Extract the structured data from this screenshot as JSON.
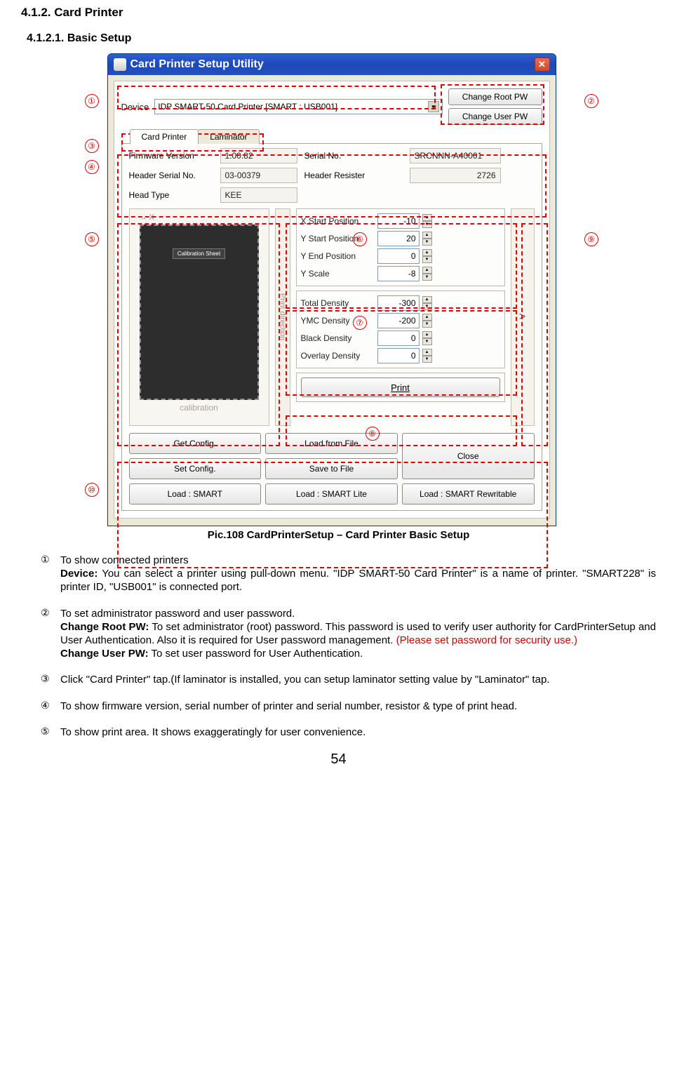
{
  "headings": {
    "h1": "4.1.2. Card Printer",
    "h2": "4.1.2.1. Basic Setup"
  },
  "titlebar": {
    "title": "Card Printer Setup Utility"
  },
  "device": {
    "label": "Device",
    "value": "IDP SMART-50 Card Printer  [SMART : USB001]",
    "btn_root": "Change Root PW",
    "btn_user": "Change User PW"
  },
  "tabs": {
    "card_printer": "Card Printer",
    "laminator": "Laminator"
  },
  "info": {
    "firmware_label": "Firmware Version",
    "firmware_value": "1.00.82",
    "serial_label": "Serial No.",
    "serial_value": "SRCNNN-A40001",
    "header_serial_label": "Header Serial No.",
    "header_serial_value": "03-00379",
    "header_resister_label": "Header Resister",
    "header_resister_value": "2726",
    "head_type_label": "Head Type",
    "head_type_value": "KEE"
  },
  "calibration": {
    "sheet": "Calibration Sheet",
    "caption": "calibration",
    "print_direction": "Print direction"
  },
  "params": {
    "xstart_label": "X Start Position",
    "xstart_value": "-10",
    "ystart_label": "Y Start Position",
    "ystart_value": "20",
    "yend_label": "Y End Position",
    "yend_value": "0",
    "yscale_label": "Y Scale",
    "yscale_value": "-8",
    "total_density_label": "Total Density",
    "total_density_value": "-300",
    "ymc_density_label": "YMC Density",
    "ymc_density_value": "-200",
    "black_density_label": "Black Density",
    "black_density_value": "0",
    "overlay_density_label": "Overlay Density",
    "overlay_density_value": "0"
  },
  "print_btn": "Print",
  "side_arrow": ">",
  "bottom": {
    "get_config": "Get Config.",
    "load_file": "Load from File",
    "close": "Close",
    "set_config": "Set Config.",
    "save_file": "Save to File",
    "load_smart": "Load : SMART",
    "load_smart_lite": "Load : SMART Lite",
    "load_smart_rewritable": "Load : SMART Rewritable"
  },
  "markers": {
    "c1": "①",
    "c2": "②",
    "c3": "③",
    "c4": "④",
    "c5": "⑤",
    "c6": "⑥",
    "c7": "⑦",
    "c8": "⑧",
    "c9": "⑨",
    "c10": "⑩"
  },
  "caption": "Pic.108    CardPrinterSetup – Card Printer Basic Setup",
  "notes": {
    "n1_num": "①",
    "n1_a": "To show connected printers",
    "n1_b_bold": "Device:",
    "n1_b_rest": " You can select a printer using pull-down menu. \"IDP SMART-50 Card Printer\" is a name of printer. \"SMART228\" is printer ID, \"USB001\" is connected port.",
    "n2_num": "②",
    "n2_a": "To set administrator password and user password.",
    "n2_b_bold": "Change Root PW:",
    "n2_b_rest": " To set administrator (root) password. This password is used to verify user authority for CardPrinterSetup and User Authentication. Also it is required for User password management. ",
    "n2_b_red": "(Please set password for security use.)",
    "n2_c_bold": "Change User PW:",
    "n2_c_rest": " To set user password for User Authentication.",
    "n3_num": "③",
    "n3": "Click \"Card Printer\" tap.(If laminator is installed, you can setup laminator setting value by \"Laminator\" tap.",
    "n4_num": "④",
    "n4": "To show firmware version, serial number of printer and serial number, resistor & type of print head.",
    "n5_num": "⑤",
    "n5": "To show print area. It shows exaggeratingly for user convenience."
  },
  "page_number": "54"
}
